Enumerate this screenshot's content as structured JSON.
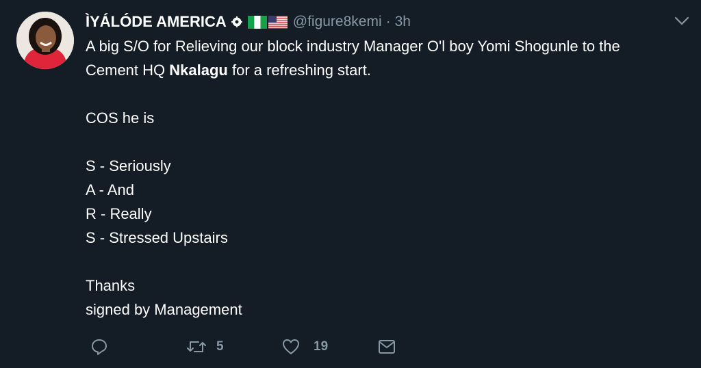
{
  "author": {
    "name": "ÌYÁLÓDE AMERICA",
    "handle": "@figure8kemi",
    "separator": "·",
    "time": "3h",
    "verified_badge_icon": "gear-badge-icon",
    "flags": [
      "nigeria-flag",
      "usa-flag"
    ]
  },
  "tweet": {
    "line1": "A big S/O for Relieving our block industry Manager O'l boy Yomi Shogunle to the",
    "line2_pre": "Cement HQ ",
    "line2_bold": "Nkalagu",
    "line2_post": " for a refreshing start.",
    "line3": "COS he is",
    "line4": "S - Seriously",
    "line5": "A - And",
    "line6": "R - Really",
    "line7": "S - Stressed Upstairs",
    "line8": "Thanks",
    "line9": "signed by Management"
  },
  "actions": {
    "reply_icon": "reply-icon",
    "retweet_icon": "retweet-icon",
    "retweet_count": "5",
    "like_icon": "heart-icon",
    "like_count": "19",
    "dm_icon": "envelope-icon"
  },
  "colors": {
    "background": "#141d26",
    "text": "#ffffff",
    "muted": "#8899a6"
  }
}
